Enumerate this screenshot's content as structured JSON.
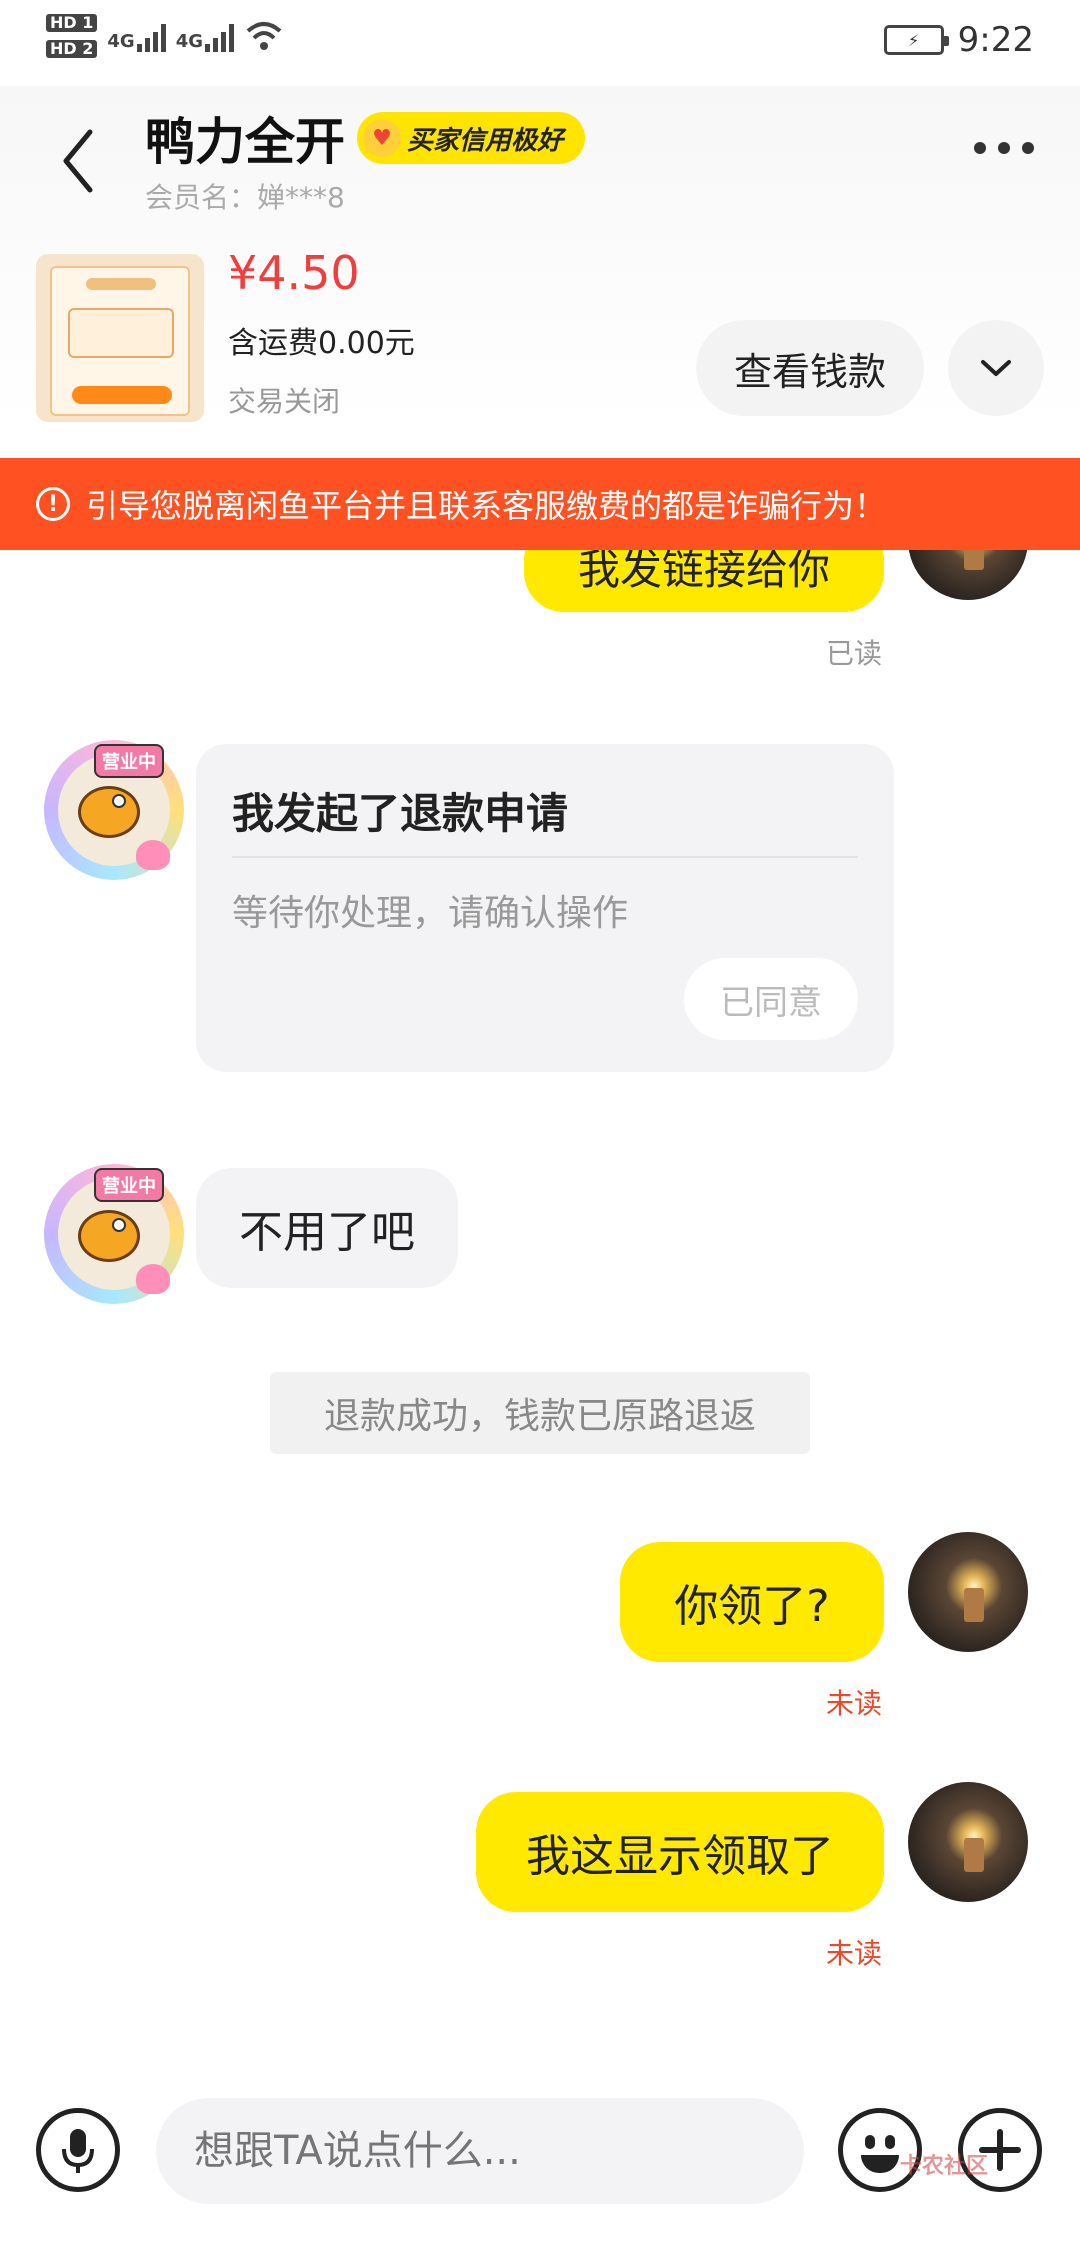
{
  "status_bar": {
    "hd1": "HD 1",
    "hd2": "HD 2",
    "net1": "4G",
    "net2": "4G",
    "time": "9:22"
  },
  "header": {
    "title": "鸭力全开",
    "credit_badge": "买家信用极好",
    "member_name": "会员名：婵***8"
  },
  "product": {
    "price": "¥4.50",
    "shipping": "含运费0.00元",
    "status": "交易关闭",
    "view_payment_label": "查看钱款"
  },
  "warning": {
    "text": "引导您脱离闲鱼平台并且联系客服缴费的都是诈骗行为！"
  },
  "messages": {
    "msg_link": "我发链接给你",
    "read_label": "已读",
    "refund_title": "我发起了退款申请",
    "refund_desc": "等待你处理，请确认操作",
    "refund_agreed": "已同意",
    "msg_no_need": "不用了吧",
    "avatar_tag": "营业中",
    "system_refund": "退款成功，钱款已原路退返",
    "msg_received_q": "你领了?",
    "unread_label_1": "未读",
    "msg_shows_received": "我这显示领取了",
    "unread_label_2": "未读"
  },
  "input": {
    "placeholder": "想跟TA说点什么..."
  },
  "watermark": "卡农社区",
  "colors": {
    "accent_yellow": "#ffe900",
    "warning_red": "#ff5122",
    "price_red": "#f23d3d",
    "unread_red": "#ea4a2a"
  }
}
